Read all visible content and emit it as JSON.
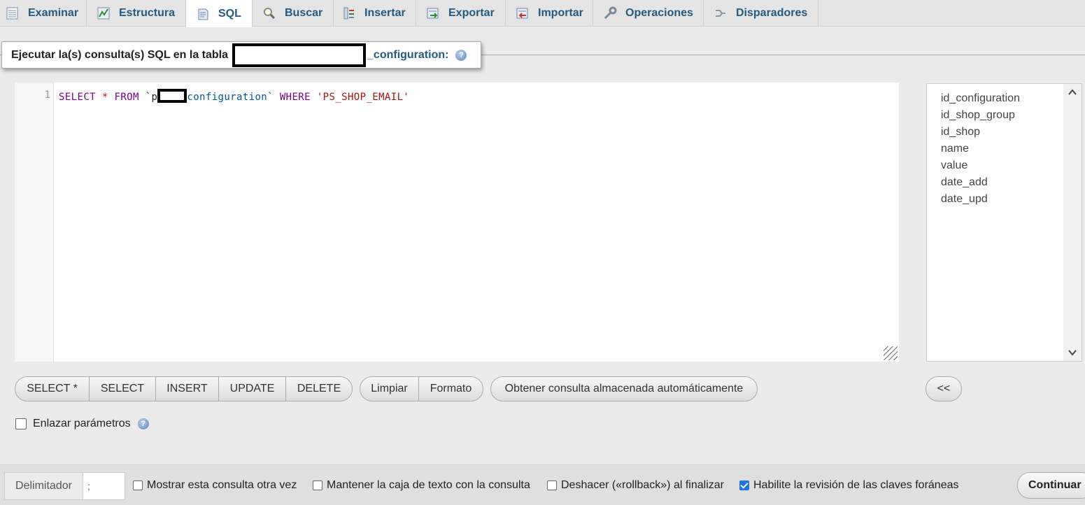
{
  "tabs": [
    {
      "label": "Examinar",
      "icon": "browse-icon"
    },
    {
      "label": "Estructura",
      "icon": "structure-icon"
    },
    {
      "label": "SQL",
      "icon": "sql-icon",
      "active": true
    },
    {
      "label": "Buscar",
      "icon": "search-icon"
    },
    {
      "label": "Insertar",
      "icon": "insert-icon"
    },
    {
      "label": "Exportar",
      "icon": "export-icon"
    },
    {
      "label": "Importar",
      "icon": "import-icon"
    },
    {
      "label": "Operaciones",
      "icon": "wrench-icon"
    },
    {
      "label": "Disparadores",
      "icon": "triggers-icon"
    }
  ],
  "legend": {
    "prefix": "Ejecutar la(s) consulta(s) SQL en la tabla",
    "table_suffix": "_configuration:"
  },
  "editor": {
    "line_number": "1",
    "kw_select": "SELECT",
    "star": "*",
    "kw_from": "FROM",
    "tbl_open": "`p",
    "tbl_close": "configuration`",
    "kw_where": "WHERE",
    "str": "'PS_SHOP_EMAIL'"
  },
  "columns": [
    "id_configuration",
    "id_shop_group",
    "id_shop",
    "name",
    "value",
    "date_add",
    "date_upd"
  ],
  "buttons": {
    "select_star": "SELECT *",
    "select": "SELECT",
    "insert": "INSERT",
    "update": "UPDATE",
    "delete": "DELETE",
    "clear": "Limpiar",
    "format": "Formato",
    "get_autosaved": "Obtener consulta almacenada automáticamente",
    "insert_column": "<<"
  },
  "bind_params": {
    "label": "Enlazar parámetros",
    "checked": false
  },
  "bottom": {
    "delimiter_label": "Delimitador",
    "delimiter_value": ";",
    "show_query_again": {
      "label": "Mostrar esta consulta otra vez",
      "checked": false
    },
    "retain_query_box": {
      "label": "Mantener la caja de texto con la consulta",
      "checked": false
    },
    "rollback": {
      "label": "Deshacer («rollback») al finalizar",
      "checked": false
    },
    "fk_checks": {
      "label": "Habilite la revisión de las claves foráneas",
      "checked": true
    },
    "submit": "Continuar"
  }
}
